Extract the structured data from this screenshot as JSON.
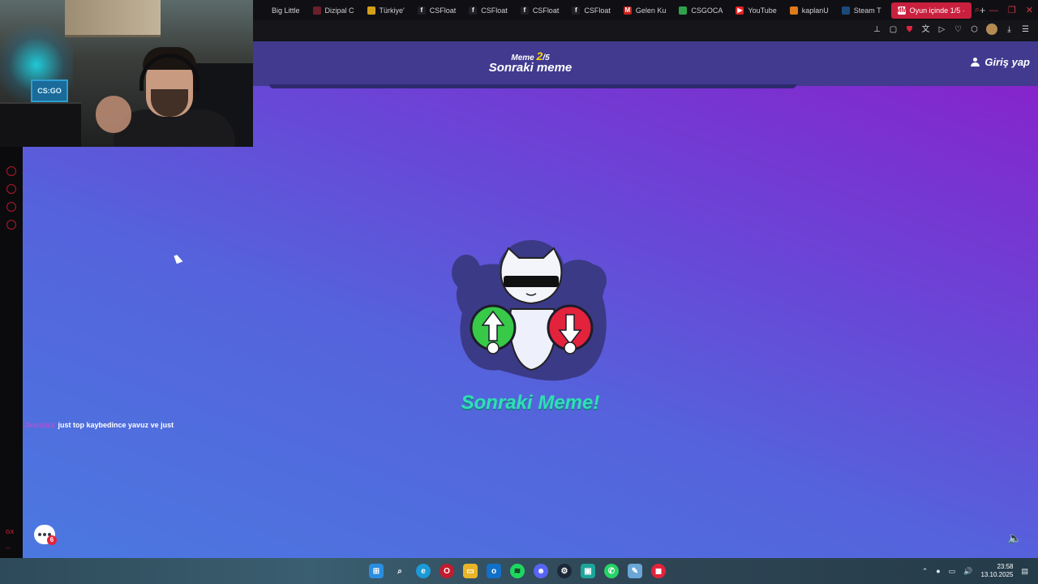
{
  "browser": {
    "tabs": [
      {
        "label": "Big Little",
        "fav_color": "#101014",
        "glyph": ""
      },
      {
        "label": "Dizipal C",
        "fav_color": "#6b1f2a",
        "glyph": ""
      },
      {
        "label": "Türkiye'",
        "fav_color": "#d4a019",
        "glyph": ""
      },
      {
        "label": "CSFloat",
        "fav_color": "#202026",
        "glyph": "f"
      },
      {
        "label": "CSFloat",
        "fav_color": "#202026",
        "glyph": "f"
      },
      {
        "label": "CSFloat",
        "fav_color": "#202026",
        "glyph": "f"
      },
      {
        "label": "CSFloat",
        "fav_color": "#202026",
        "glyph": "f"
      },
      {
        "label": "Gelen Ku",
        "fav_color": "#c5221f",
        "glyph": "M"
      },
      {
        "label": "CSGOCA",
        "fav_color": "#2fa34a",
        "glyph": ""
      },
      {
        "label": "YouTube",
        "fav_color": "#e52222",
        "glyph": "▶"
      },
      {
        "label": "kaplanU",
        "fav_color": "#e07a1a",
        "glyph": ""
      },
      {
        "label": "Steam T",
        "fav_color": "#1b4a7a",
        "glyph": ""
      },
      {
        "label": "Oyun içinde 1/5 ·",
        "fav_color": "#ffffff",
        "glyph": "MM",
        "active": true
      }
    ],
    "new_tab_symbol": "+"
  },
  "page": {
    "progress_prefix": "Meme",
    "progress_current": "2",
    "progress_suffix": "/5",
    "title": "Sonraki meme",
    "login_label": "Giriş yap",
    "cta_label": "Sonraki Meme!",
    "accent_color": "#2fe0b4",
    "upvote_color": "#37c947",
    "downvote_color": "#e3223c"
  },
  "webcam": {
    "monitor_text": "CS:GO"
  },
  "chat": {
    "username": "Jkansize",
    "message": "just top kaybedince yavuz ve just",
    "unread_count": "6"
  },
  "sidebar": {
    "bottom_label": "GX",
    "more_label": "..."
  },
  "taskbar": {
    "time": "23:58",
    "date": "13.10.2025"
  }
}
